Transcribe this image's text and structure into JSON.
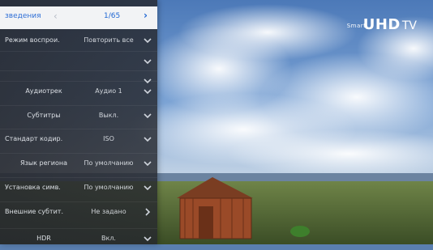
{
  "brand": {
    "smart": "Smart",
    "uhd": "UHD",
    "tv": "TV"
  },
  "header": {
    "title": "зведения",
    "prev": "‹",
    "counter": "1/65",
    "next": "›"
  },
  "menu": [
    {
      "label": "Режим воспрои.",
      "value": "Повторить все",
      "align": "left"
    },
    {
      "label": "",
      "value": "",
      "align": "left"
    },
    {
      "label": "",
      "value": "",
      "align": "left"
    },
    {
      "label": "Аудиотрек",
      "value": "Аудио 1",
      "align": "center"
    },
    {
      "label": "Субтитры",
      "value": "Выкл.",
      "align": "center"
    },
    {
      "label": "Стандарт кодир.",
      "value": "ISO",
      "align": "left"
    },
    {
      "label": "Язык региона",
      "value": "По умолчанию",
      "align": "center"
    },
    {
      "label": "Установка симв.",
      "value": "По умолчанию",
      "align": "left"
    },
    {
      "label": "Внешние субтит.",
      "value": "Не задано",
      "align": "left"
    },
    {
      "label": "HDR",
      "value": "Вкл.",
      "align": "center"
    }
  ],
  "icons": {
    "chevron": "chevron-down-icon",
    "right": "chevron-right-icon"
  },
  "colors": {
    "accent": "#1f66d3",
    "panel": "#26282e",
    "text": "#e9edf2"
  }
}
